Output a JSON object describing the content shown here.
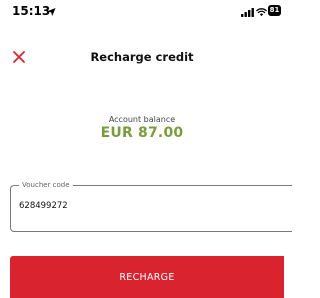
{
  "status_bar": {
    "time": "15:13",
    "location_icon": "location-arrow-icon",
    "signal_icon": "cellular-signal-icon",
    "wifi_icon": "wifi-icon",
    "battery_level": "81"
  },
  "header": {
    "title": "Recharge credit",
    "close_icon": "close-icon",
    "close_color": "#d9232e"
  },
  "balance": {
    "label": "Account balance",
    "value": "EUR 87.00",
    "color": "#7a9c3c"
  },
  "voucher": {
    "label": "Voucher code",
    "value": "628499272"
  },
  "recharge_button": {
    "label": "RECHARGE",
    "color": "#d9232e"
  }
}
